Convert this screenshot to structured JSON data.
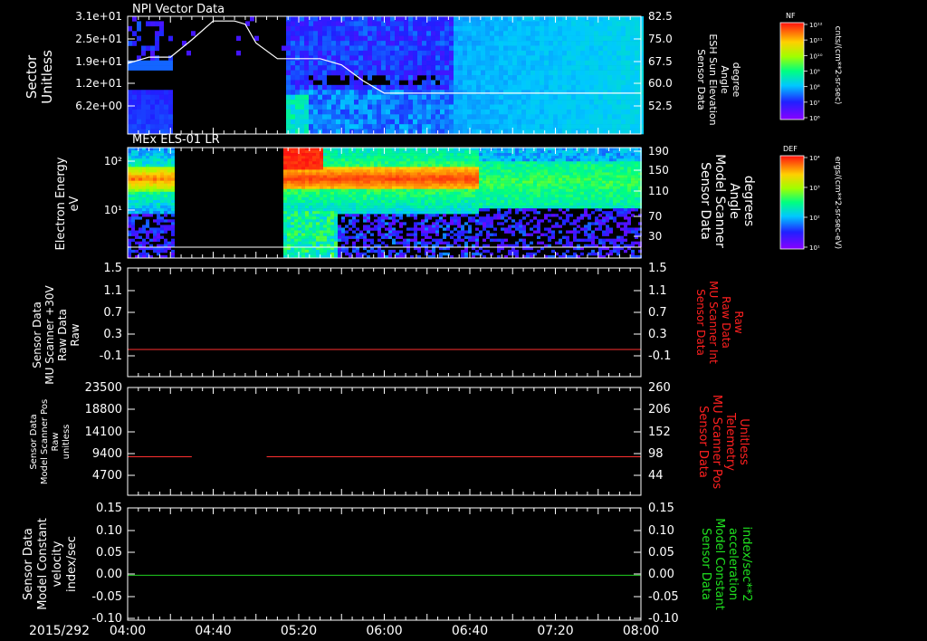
{
  "date_label": "2015/292",
  "x_ticks": [
    "04:00",
    "04:40",
    "05:20",
    "06:00",
    "06:40",
    "07:20",
    "08:00"
  ],
  "colors": {
    "background": "#000000",
    "axis": "#ffffff",
    "red_label": "#ff2020",
    "green_label": "#20e020",
    "red_line": "#ff3030",
    "green_line": "#20d020"
  },
  "colorbars": [
    {
      "title": "NF",
      "unit": "cnts/(cm**2-sr-sec)",
      "tick_labels": [
        "10¹²",
        "10¹¹",
        "10¹⁰",
        "10⁹",
        "10⁸",
        "10⁷",
        "10⁶"
      ]
    },
    {
      "title": "DEF",
      "unit": "ergs/(cm**2-sr-sec-eV)",
      "tick_labels": [
        "10⁴",
        "10³",
        "10²",
        "10¹"
      ]
    }
  ],
  "chart_data": [
    {
      "type": "heatmap",
      "title": "NPI Vector Data",
      "ylabel": [
        "Sector",
        "Unitless"
      ],
      "yticks": [
        "3.1e+01",
        "2.5e+01",
        "1.9e+01",
        "1.2e+01",
        "6.2e+00"
      ],
      "y2label": [
        "Sensor Data",
        "ESH Sun Elevation",
        "Angle",
        "degree"
      ],
      "y2ticks": [
        "82.5",
        "75.0",
        "67.5",
        "60.0",
        "52.5"
      ],
      "y2lim": [
        45,
        82.5
      ],
      "overlay_line": {
        "x": [
          "04:00",
          "04:10",
          "04:20",
          "04:30",
          "04:40",
          "04:50",
          "04:55",
          "05:00",
          "05:10",
          "05:20",
          "05:30",
          "05:40",
          "05:50",
          "06:00",
          "06:40",
          "08:00"
        ],
        "y": [
          67.5,
          69.5,
          69.5,
          75,
          81,
          81,
          80,
          74,
          69,
          69,
          69,
          67,
          62,
          58,
          58,
          58
        ]
      },
      "data_gaps": [
        [
          "04:21",
          "05:12"
        ]
      ]
    },
    {
      "type": "heatmap",
      "title": "MEx ELS-01 LR",
      "ylabel": [
        "Electron Energy",
        "eV"
      ],
      "yticks": [
        "10²",
        "10¹"
      ],
      "y2label": [
        "Sensor Data",
        "Model Scanner",
        "Angle",
        "degrees"
      ],
      "y2ticks": [
        "190",
        "150",
        "110",
        "70",
        "30"
      ],
      "y2lim": [
        0,
        190
      ],
      "overlay_line": {
        "x": [
          "04:00",
          "08:00"
        ],
        "y": [
          6,
          6
        ]
      },
      "data_gaps": [
        [
          "04:21",
          "05:12"
        ]
      ]
    },
    {
      "type": "line",
      "ylabel": [
        "Sensor Data",
        "MU Scanner +30V",
        "Raw Data",
        "Raw"
      ],
      "yticks": [
        "1.5",
        "1.1",
        "0.7",
        "0.3",
        "-0.1"
      ],
      "ylim": [
        -0.5,
        1.5
      ],
      "y2label": [
        "Sensor Data",
        "MU Scanner Int",
        "Raw Data",
        "Raw"
      ],
      "y2ticks": [
        "1.5",
        "1.1",
        "0.7",
        "0.3",
        "-0.1"
      ],
      "series": [
        {
          "x": [
            "04:00",
            "08:00"
          ],
          "values": [
            0,
            0
          ]
        }
      ]
    },
    {
      "type": "line",
      "ylabel": [
        "Sensor Data",
        "Model Scanner Pos",
        "Raw",
        "unitless"
      ],
      "yticks": [
        "23500",
        "18800",
        "14100",
        "9400",
        "4700"
      ],
      "ylim": [
        0,
        23500
      ],
      "y2label": [
        "Sensor Data",
        "MU Scanner Pos",
        "Telemetry",
        "Unitless"
      ],
      "y2ticks": [
        "260",
        "206",
        "152",
        "98",
        "44"
      ],
      "series": [
        {
          "segments": [
            [
              [
                "04:00",
                8400
              ],
              [
                "04:30",
                8400
              ]
            ],
            [
              [
                "05:05",
                8400
              ],
              [
                "08:00",
                8400
              ]
            ]
          ]
        }
      ]
    },
    {
      "type": "line",
      "ylabel": [
        "Sensor Data",
        "Model Constant",
        "velocity",
        "index/sec"
      ],
      "yticks": [
        "0.15",
        "0.10",
        "0.05",
        "0.00",
        "-0.05",
        "-0.10"
      ],
      "ylim": [
        -0.1,
        0.15
      ],
      "y2label": [
        "Sensor Data",
        "Model Constant",
        "acceleration",
        "index/sec**2"
      ],
      "y2ticks": [
        "0.15",
        "0.10",
        "0.05",
        "0.00",
        "-0.05",
        "-0.10"
      ],
      "series": [
        {
          "x": [
            "04:00",
            "08:00"
          ],
          "values": [
            0,
            0
          ]
        }
      ]
    }
  ]
}
